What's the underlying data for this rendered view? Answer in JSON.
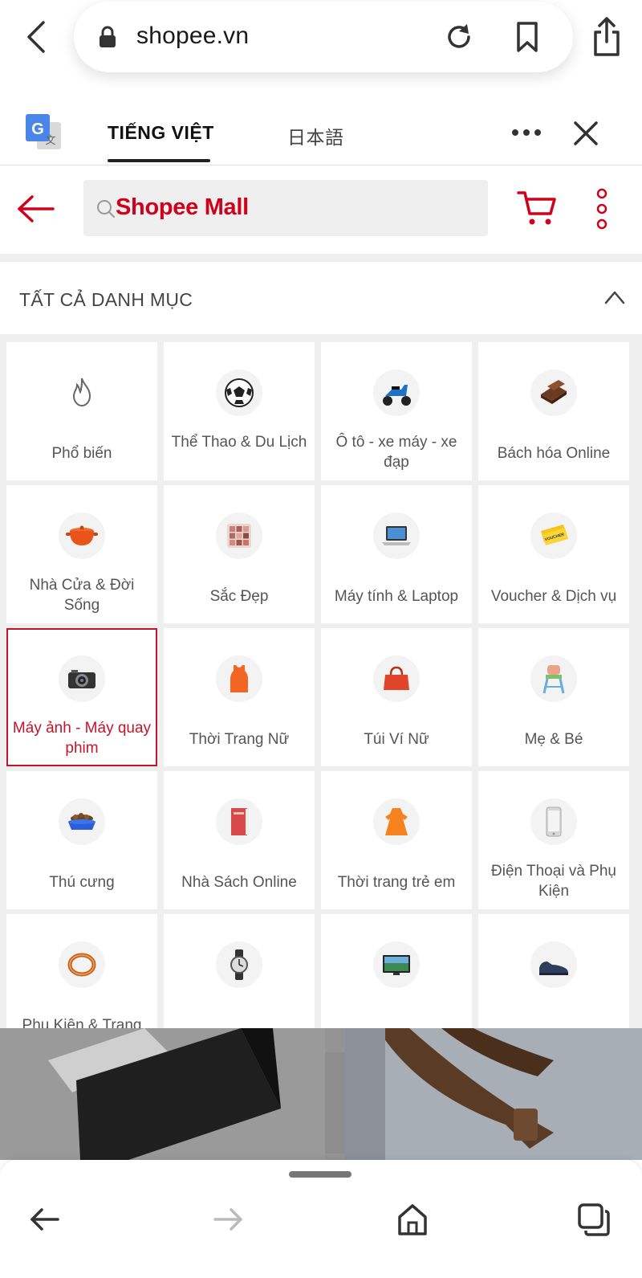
{
  "browser": {
    "url": "shopee.vn"
  },
  "translate_bar": {
    "languages": [
      "TIẾNG VIỆT",
      "日本語"
    ],
    "active_language": "TIẾNG VIỆT"
  },
  "header": {
    "search_brand": "Shopee Mall"
  },
  "section": {
    "title": "TẤT CẢ DANH MỤC"
  },
  "categories": [
    {
      "label": "Phổ biến",
      "icon": "fire-icon"
    },
    {
      "label": "Thể Thao & Du Lịch",
      "icon": "soccer-ball-icon"
    },
    {
      "label": "Ô tô - xe máy - xe đạp",
      "icon": "scooter-icon"
    },
    {
      "label": "Bách hóa Online",
      "icon": "chocolate-icon"
    },
    {
      "label": "Nhà Cửa & Đời Sống",
      "icon": "cooking-pot-icon"
    },
    {
      "label": "Sắc Đẹp",
      "icon": "eyeshadow-palette-icon"
    },
    {
      "label": "Máy tính & Laptop",
      "icon": "laptop-icon"
    },
    {
      "label": "Voucher & Dịch vụ",
      "icon": "voucher-ticket-icon"
    },
    {
      "label": "Máy ảnh - Máy quay phim",
      "icon": "camera-icon",
      "selected": true
    },
    {
      "label": "Thời Trang Nữ",
      "icon": "tank-top-icon"
    },
    {
      "label": "Túi Ví Nữ",
      "icon": "handbag-icon"
    },
    {
      "label": "Mẹ & Bé",
      "icon": "high-chair-icon"
    },
    {
      "label": "Thú cưng",
      "icon": "pet-bowl-icon"
    },
    {
      "label": "Nhà Sách Online",
      "icon": "book-icon"
    },
    {
      "label": "Thời trang trẻ em",
      "icon": "kids-dress-icon"
    },
    {
      "label": "Điện Thoại và Phụ Kiện",
      "icon": "smartphone-icon"
    },
    {
      "label": "Phụ Kiện & Trang",
      "icon": "bracelet-icon"
    },
    {
      "label": "",
      "icon": "wristwatch-icon"
    },
    {
      "label": "",
      "icon": "television-icon"
    },
    {
      "label": "",
      "icon": "shoe-icon"
    }
  ],
  "colors": {
    "brand_red": "#d0011b",
    "selected_border": "#c4142b"
  }
}
